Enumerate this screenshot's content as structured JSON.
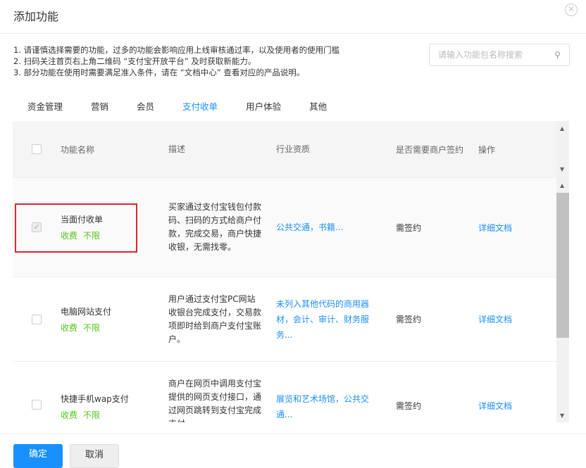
{
  "title": "添加功能",
  "notes": [
    "1. 请谨慎选择需要的功能，过多的功能会影响应用上线审核通过率，以及使用者的使用门槛",
    "2. 扫码关注首页右上角二维码 “支付宝开放平台” 及时获取新能力。",
    "3. 部分功能在使用时需要满足准入条件，请在 “文档中心” 查看对应的产品说明。"
  ],
  "search_placeholder": "请输入功能包名称搜索",
  "tabs": [
    "资金管理",
    "营销",
    "会员",
    "支付收单",
    "用户体验",
    "其他"
  ],
  "headers": [
    "功能名称",
    "描述",
    "行业资质",
    "是否需要商户签约",
    "操作"
  ],
  "rows": [
    {
      "name": "当面付收单",
      "fee": "收费",
      "limit": "不限",
      "desc": "买家通过支付宝钱包付款码、扫码的方式给商户付款，完成交易，商户快捷收银，无需找零。",
      "industry": "公共交通，书籍...",
      "sign": "需签约",
      "action": "详细文档",
      "checked": true
    },
    {
      "name": "电脑网站支付",
      "fee": "收费",
      "limit": "不限",
      "desc": "用户通过支付宝PC网站收银台完成支付，交易款项即时给到商户支付宝账户。",
      "industry": "未列入其他代码的商用器材，会计、审计、财务服务...",
      "sign": "需签约",
      "action": "详细文档",
      "checked": false
    },
    {
      "name": "快捷手机wap支付",
      "fee": "收费",
      "limit": "不限",
      "desc": "商户在网页中调用支付宝提供的网页支付接口，通过网页跳转到支付宝完成支付",
      "industry": "展览和艺术场馆，公共交通...",
      "sign": "需签约",
      "action": "详细文档",
      "checked": false
    }
  ],
  "confirm": "确定",
  "cancel": "取消"
}
